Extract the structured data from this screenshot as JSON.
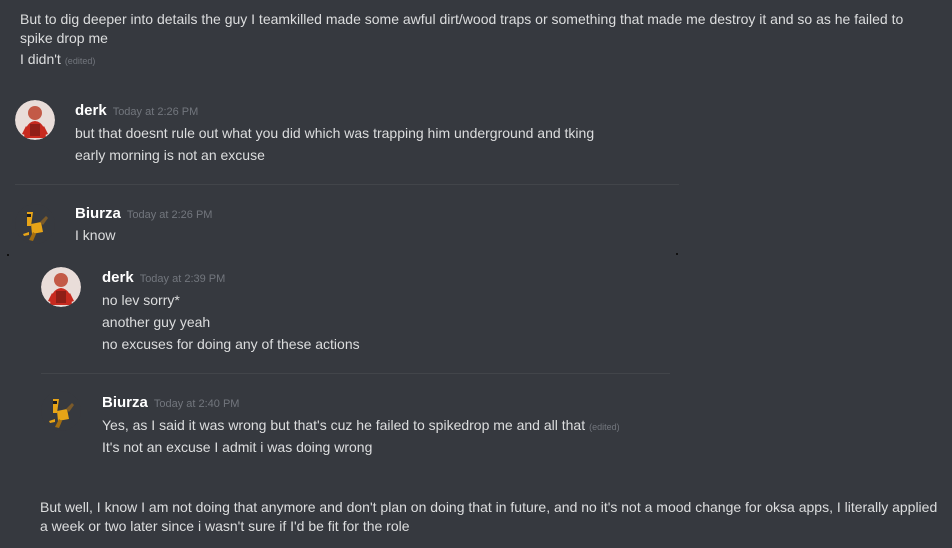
{
  "top": {
    "line1": "But to dig deeper into details the guy I teamkilled made some awful dirt/wood traps or something that made me destroy it and so as he failed to",
    "line2": "spike drop me",
    "line3": "I didn't",
    "edited": "(edited)"
  },
  "msg1": {
    "author": "derk",
    "timestamp": "Today at 2:26 PM",
    "lines": [
      "but that doesnt rule out what you did which was trapping him underground and tking",
      "early morning is not an excuse"
    ]
  },
  "msg2": {
    "author": "Biurza",
    "timestamp": "Today at 2:26 PM",
    "lines": [
      "I know"
    ]
  },
  "msg3": {
    "author": "derk",
    "timestamp": "Today at 2:39 PM",
    "lines": [
      "no lev sorry*",
      "another guy yeah",
      "no excuses for doing any of these actions"
    ]
  },
  "msg4": {
    "author": "Biurza",
    "timestamp": "Today at 2:40 PM",
    "lines": [
      "Yes, as I said it was wrong but that's cuz he failed to spikedrop me and all that",
      "It's not an excuse I admit i was doing wrong"
    ],
    "edited": "(edited)"
  },
  "bottom": {
    "line1": "But well, I know I am not doing that anymore and don't plan on doing that in future, and no it's not a mood change for oksa apps, I literally applied",
    "line2": "a week or two later since i wasn't sure if I'd be fit for the role"
  },
  "colors": {
    "background": "#36393f",
    "text": "#dcddde",
    "username": "#ffffff",
    "timestamp": "#72767d",
    "divider": "#42454a"
  }
}
